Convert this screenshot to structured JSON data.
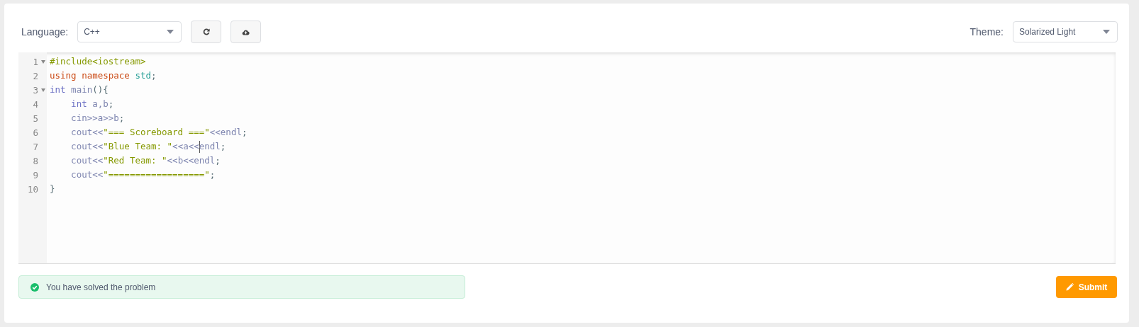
{
  "toolbar": {
    "language_label": "Language:",
    "language": "C++",
    "theme_label": "Theme:",
    "theme": "Solarized Light"
  },
  "editor": {
    "lines": [
      {
        "number": "1",
        "foldable": true,
        "tokens": [
          {
            "kind": "preproc",
            "text": "#include<iostream>"
          }
        ]
      },
      {
        "number": "2",
        "foldable": false,
        "tokens": [
          {
            "kind": "keyword",
            "text": "using namespace"
          },
          {
            "kind": "namespace",
            "text": " std"
          },
          {
            "kind": "plain",
            "text": ";"
          }
        ]
      },
      {
        "number": "3",
        "foldable": true,
        "tokens": [
          {
            "kind": "type",
            "text": "int"
          },
          {
            "kind": "ident",
            "text": " main"
          },
          {
            "kind": "paren",
            "text": "(){"
          }
        ]
      },
      {
        "number": "4",
        "foldable": false,
        "tokens": [
          {
            "kind": "type",
            "text": "    int"
          },
          {
            "kind": "ident",
            "text": " a,b"
          },
          {
            "kind": "plain",
            "text": ";"
          }
        ]
      },
      {
        "number": "5",
        "foldable": false,
        "tokens": [
          {
            "kind": "ident",
            "text": "    cin>>a>>b"
          },
          {
            "kind": "plain",
            "text": ";"
          }
        ]
      },
      {
        "number": "6",
        "foldable": false,
        "tokens": [
          {
            "kind": "ident",
            "text": "    cout<<"
          },
          {
            "kind": "string",
            "text": "\"=== Scoreboard ===\""
          },
          {
            "kind": "ident",
            "text": "<<endl"
          },
          {
            "kind": "plain",
            "text": ";"
          }
        ]
      },
      {
        "number": "7",
        "foldable": false,
        "tokens": [
          {
            "kind": "ident",
            "text": "    cout<<"
          },
          {
            "kind": "string",
            "text": "\"Blue Team: \""
          },
          {
            "kind": "ident",
            "text": "<<a<<"
          },
          {
            "kind": "ident",
            "text": "endl",
            "cursor": true
          },
          {
            "kind": "plain",
            "text": ";"
          }
        ]
      },
      {
        "number": "8",
        "foldable": false,
        "tokens": [
          {
            "kind": "ident",
            "text": "    cout<<"
          },
          {
            "kind": "string",
            "text": "\"Red Team: \""
          },
          {
            "kind": "ident",
            "text": "<<b<<endl"
          },
          {
            "kind": "plain",
            "text": ";"
          }
        ]
      },
      {
        "number": "9",
        "foldable": false,
        "tokens": [
          {
            "kind": "ident",
            "text": "    cout<<"
          },
          {
            "kind": "string",
            "text": "\"==================\""
          },
          {
            "kind": "plain",
            "text": ";"
          }
        ]
      },
      {
        "number": "10",
        "foldable": false,
        "tokens": [
          {
            "kind": "paren",
            "text": "}"
          }
        ]
      }
    ]
  },
  "status": {
    "kind": "success",
    "message": "You have solved the problem"
  },
  "submit": {
    "label": "Submit"
  }
}
